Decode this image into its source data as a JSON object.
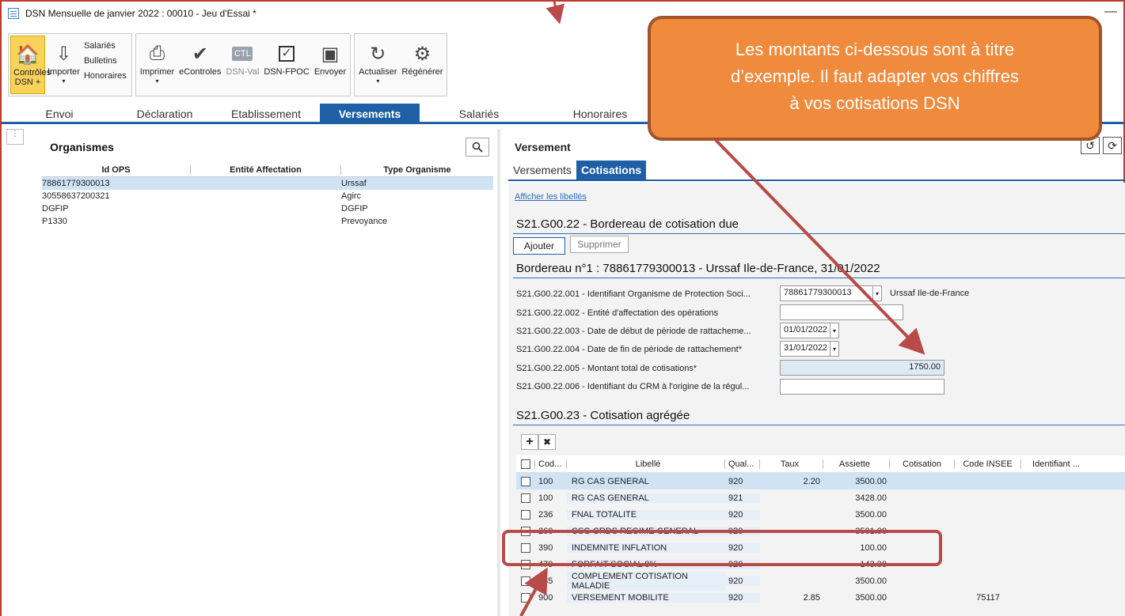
{
  "window": {
    "title": "DSN Mensuelle de janvier 2022 : 00010 - Jeu d'Essai *"
  },
  "ribbon": {
    "controles": "Contrôles DSN +",
    "importer": "Importer",
    "sublist": [
      "Salariés",
      "Bulletins",
      "Honoraires"
    ],
    "imprimer": "Imprimer",
    "econtroles": "eControles",
    "ctl_icon": "CTL",
    "dsnval": "DSN-Val",
    "dsnfpoc": "DSN-FPOC",
    "envoyer": "Envoyer",
    "actualiser": "Actualiser",
    "regenerer": "Régénérer"
  },
  "tabs": [
    "Envoi",
    "Déclaration",
    "Etablissement",
    "Versements",
    "Salariés",
    "Honoraires",
    "I"
  ],
  "organismes": {
    "title": "Organismes",
    "headers": [
      "Id OPS",
      "Entité Affectation",
      "Type Organisme"
    ],
    "rows": [
      [
        "78861779300013",
        "",
        "Urssaf"
      ],
      [
        "30558637200321",
        "",
        "Agirc"
      ],
      [
        "DGFIP",
        "",
        "DGFIP"
      ],
      [
        "P1330",
        "",
        "Prevoyance"
      ]
    ]
  },
  "versement": {
    "title": "Versement",
    "subtabs": [
      "Versements",
      "Cotisations"
    ],
    "link": "Afficher les libellés",
    "section1": "S21.G00.22 - Bordereau de cotisation due",
    "ajouter": "Ajouter",
    "supprimer": "Supprimer",
    "bordereau": "Bordereau n°1 : 78861779300013 - Urssaf Ile-de-France, 31/01/2022",
    "fields": [
      {
        "label": "S21.G00.22.001 - Identifiant Organisme de Protection Soci...",
        "value": "78861779300013",
        "extra": "Urssaf Ile-de-France"
      },
      {
        "label": "S21.G00.22.002 - Entité d'affectation des opérations",
        "value": ""
      },
      {
        "label": "S21.G00.22.003 - Date de début de période de rattacheme...",
        "value": "01/01/2022"
      },
      {
        "label": "S21.G00.22.004 - Date de fin de période de rattachement*",
        "value": "31/01/2022"
      },
      {
        "label": "S21.G00.22.005 - Montant total de cotisations*",
        "value": "1750.00"
      },
      {
        "label": "S21.G00.22.006 - Identifiant du CRM à l'origine de la régul...",
        "value": ""
      }
    ],
    "section2": "S21.G00.23 - Cotisation agrégée",
    "table_headers": [
      "Cod...",
      "Libellé",
      "Qual...",
      "Taux",
      "Assiette",
      "Cotisation",
      "Code INSEE",
      "Identifiant ..."
    ],
    "table_rows": [
      [
        "100",
        "RG CAS GENERAL",
        "920",
        "2.20",
        "3500.00",
        "",
        "",
        ""
      ],
      [
        "100",
        "RG CAS GENERAL",
        "921",
        "",
        "3428.00",
        "",
        "",
        ""
      ],
      [
        "236",
        "FNAL TOTALITE",
        "920",
        "",
        "3500.00",
        "",
        "",
        ""
      ],
      [
        "260",
        "CSG CRDS REGIME GENERAL",
        "920",
        "",
        "3501.00",
        "",
        "",
        ""
      ],
      [
        "390",
        "INDEMNITE INFLATION",
        "920",
        "",
        "100.00",
        "",
        "",
        ""
      ],
      [
        "479",
        "FORFAIT SOCIAL 8%",
        "920",
        "",
        "143.00",
        "",
        "",
        ""
      ],
      [
        "635",
        "COMPLEMENT COTISATION MALADIE",
        "920",
        "",
        "3500.00",
        "",
        "",
        ""
      ],
      [
        "900",
        "VERSEMENT MOBILITE",
        "920",
        "2.85",
        "3500.00",
        "",
        "75117",
        ""
      ]
    ]
  },
  "callout": {
    "lines": [
      "Les montants ci-dessous sont à titre",
      "d’exemple. Il faut adapter vos chiffres",
      "à vos cotisations DSN"
    ]
  },
  "colors": {
    "accent": "#1e5fa6",
    "callout": "#f08a3c",
    "arrow": "#b84a47"
  }
}
